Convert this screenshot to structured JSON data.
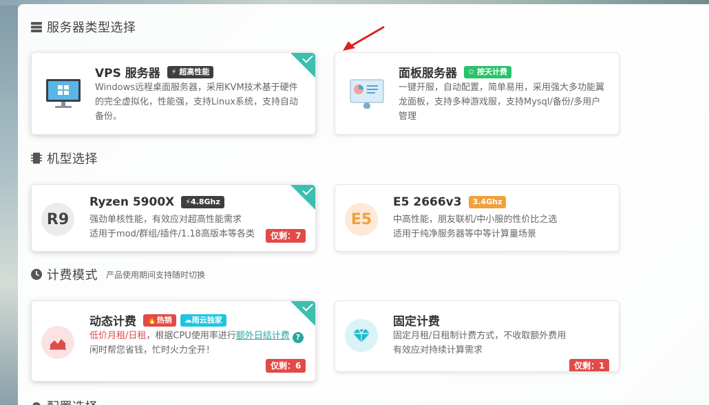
{
  "sections": {
    "server_type": {
      "title": "服务器类型选择"
    },
    "model": {
      "title": "机型选择"
    },
    "billing": {
      "title": "计费模式",
      "subtitle": "产品使用期间支持随时切换"
    },
    "config": {
      "title": "配置选择"
    }
  },
  "server_types": [
    {
      "title": "VPS 服务器",
      "badge": "⚡ 超高性能",
      "desc": "Windows远程桌面服务器，采用KVM技术基于硬件的完全虚拟化，性能强，支持Linux系统，支持自动备份。",
      "icon": "monitor-windows-icon",
      "selected": true
    },
    {
      "title": "面板服务器",
      "badge": "✩ 按天计费",
      "desc": "一键开服，自动配置，简单易用，采用强大多功能翼龙面板，支持多种游戏服，支持Mysql/备份/多用户管理",
      "icon": "dashboard-chart-icon",
      "selected": false
    }
  ],
  "models": [
    {
      "title": "Ryzen 5900X",
      "badge": "⚡4.8Ghz",
      "icon_text": "R9",
      "line1": "强劲单核性能，有效应对超高性能需求",
      "line2": "适用于mod/群组/插件/1.18高版本等各类",
      "stock": "仅剩：7",
      "selected": true
    },
    {
      "title": "E5 2666v3",
      "badge": "3.4Ghz",
      "icon_text": "E5",
      "line1": "中高性能，朋友联机/中小服的性价比之选",
      "line2": "适用于纯净服务器等中等计算量场景",
      "selected": false
    }
  ],
  "billing": [
    {
      "title": "动态计费",
      "badge1": "🔥热销",
      "badge2": "☁雨云独家",
      "desc_red": "低价月租/日租",
      "desc_mid": "，根据CPU使用率进行",
      "desc_link": "额外日结计费",
      "help": "?",
      "line2": "闲时帮您省钱，忙时火力全开！",
      "stock": "仅剩：6",
      "icon": "area-chart-icon",
      "selected": true
    },
    {
      "title": "固定计费",
      "line1": "固定月租/日租制计费方式，不收取额外费用",
      "line2": "有效应对持续计算需求",
      "stock": "仅剩：1",
      "icon": "diamond-icon",
      "selected": false
    }
  ],
  "colors": {
    "accent": "#3cbfae",
    "red": "#e04b48",
    "green": "#27c36b",
    "orange": "#f0a03c",
    "cyan": "#22c4e0"
  }
}
